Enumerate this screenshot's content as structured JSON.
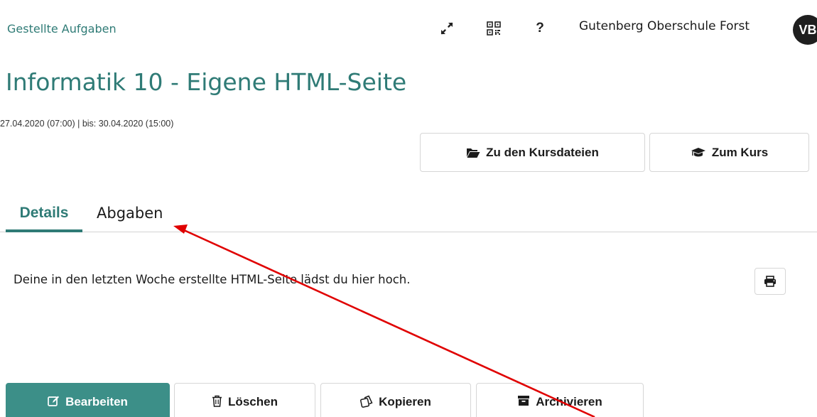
{
  "header": {
    "breadcrumb": "Gestellte Aufgaben",
    "school_name": "Gutenberg Oberschule Forst",
    "avatar_initials": "VB",
    "help_label": "?",
    "icons": [
      "fullscreen-icon",
      "qr-code-icon",
      "help-icon"
    ]
  },
  "task": {
    "title": "Informatik 10 - Eigene HTML-Seite",
    "date_range": "27.04.2020 (07:00) | bis: 30.04.2020 (15:00)",
    "description": "Deine in den letzten Woche erstellte HTML-Seite lädst du hier hoch."
  },
  "links": {
    "course_files": "Zu den Kursdateien",
    "course": "Zum Kurs"
  },
  "tabs": [
    {
      "label": "Details",
      "active": true
    },
    {
      "label": "Abgaben",
      "active": false
    }
  ],
  "actions": {
    "edit": "Bearbeiten",
    "delete": "Löschen",
    "copy": "Kopieren",
    "archive": "Archivieren"
  },
  "colors": {
    "accent": "#2f7b76",
    "primary_button": "#3c8f88",
    "annotation_arrow": "#e00000"
  }
}
